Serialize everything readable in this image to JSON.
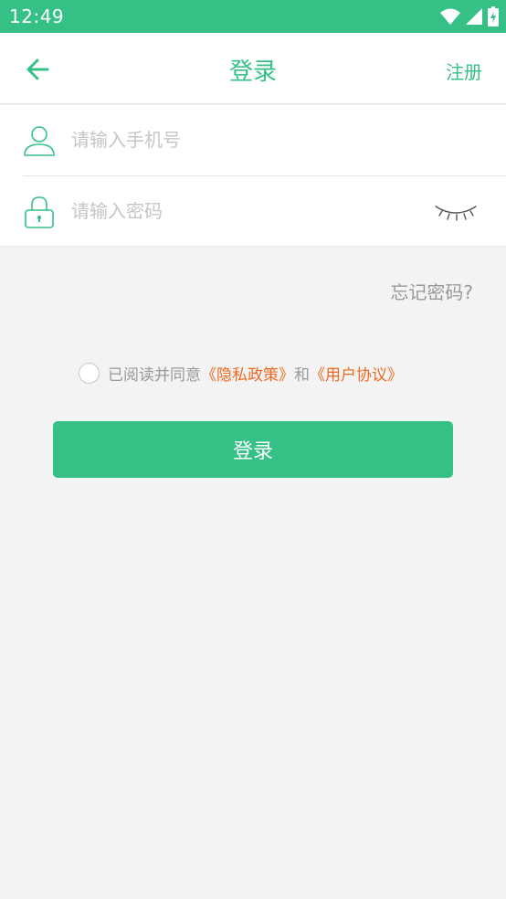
{
  "status_bar": {
    "time": "12:49",
    "icons": [
      "wifi-icon",
      "signal-icon",
      "battery-charging-icon"
    ]
  },
  "nav": {
    "title": "登录",
    "register_label": "注册",
    "back_icon": "arrow-left-icon"
  },
  "form": {
    "phone_placeholder": "请输入手机号",
    "phone_value": "",
    "password_placeholder": "请输入密码",
    "password_value": "",
    "phone_icon": "user-icon",
    "password_icon": "lock-icon",
    "toggle_icon": "eye-closed-icon"
  },
  "forgot_label": "忘记密码?",
  "agreement": {
    "prefix": "已阅读并同意",
    "privacy_link": "《隐私政策》",
    "conjunction": "和",
    "terms_link": "《用户协议》",
    "checked": false
  },
  "login_button_label": "登录",
  "colors": {
    "accent": "#35c086",
    "link": "#ef6a21",
    "placeholder": "#c6c6c6",
    "muted": "#999999",
    "background": "#f3f3f3"
  }
}
